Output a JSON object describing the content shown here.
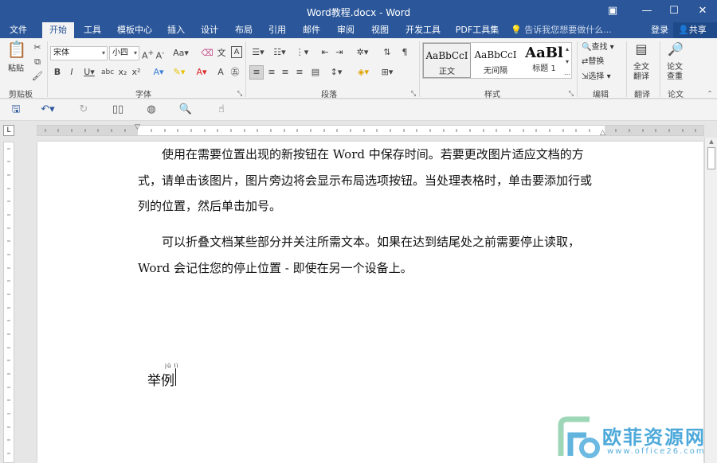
{
  "window": {
    "title": "Word教程.docx - Word",
    "ribbon_opts_icon": "ribbon-display-options-icon",
    "minimize_icon": "minimize-icon",
    "maximize_icon": "maximize-icon",
    "close_icon": "close-icon"
  },
  "tabs": [
    "文件",
    "开始",
    "工具",
    "模板中心",
    "插入",
    "设计",
    "布局",
    "引用",
    "邮件",
    "审阅",
    "视图",
    "开发工具",
    "PDF工具集"
  ],
  "active_tab": "开始",
  "tell_me": "告诉我您想要做什么...",
  "login": "登录",
  "share": "共享",
  "clipboard": {
    "paste": "粘贴",
    "label": "剪贴板"
  },
  "font": {
    "name": "宋体",
    "size": "小四",
    "label": "字体"
  },
  "paragraph": {
    "label": "段落"
  },
  "styles": {
    "label": "样式",
    "items": [
      {
        "sample": "AaBbCcI",
        "name": "正文"
      },
      {
        "sample": "AaBbCcI",
        "name": "无间隔"
      },
      {
        "sample": "AaBl",
        "name": "标题 1"
      }
    ]
  },
  "editing": {
    "find": "查找",
    "replace": "替换",
    "select": "选择",
    "label": "编辑"
  },
  "translate": {
    "full": "全文",
    "full2": "翻译",
    "label": "翻译"
  },
  "paper": {
    "check1": "论文",
    "check2": "查重",
    "label": "论文"
  },
  "document": {
    "paragraphs": [
      "使用在需要位置出现的新按钮在 Word 中保存时间。若要更改图片适应文档的方式，请单击该图片，图片旁边将会显示布局选项按钮。当处理表格时，单击要添加行或列的位置，然后单击加号。",
      "可以折叠文档某些部分并关注所需文本。如果在达到结尾处之前需要停止读取，Word 会记住您的停止位置 - 即使在另一个设备上。"
    ],
    "ruby_text": "举例",
    "ruby_pinyin": "jǔ lì"
  },
  "watermark": {
    "name": "欧菲资源网",
    "url": "www.office26.com"
  },
  "colors": {
    "brand": "#2b579a",
    "ribbon_bg": "#f3f3f3",
    "watermark": "#2e9bd4"
  }
}
